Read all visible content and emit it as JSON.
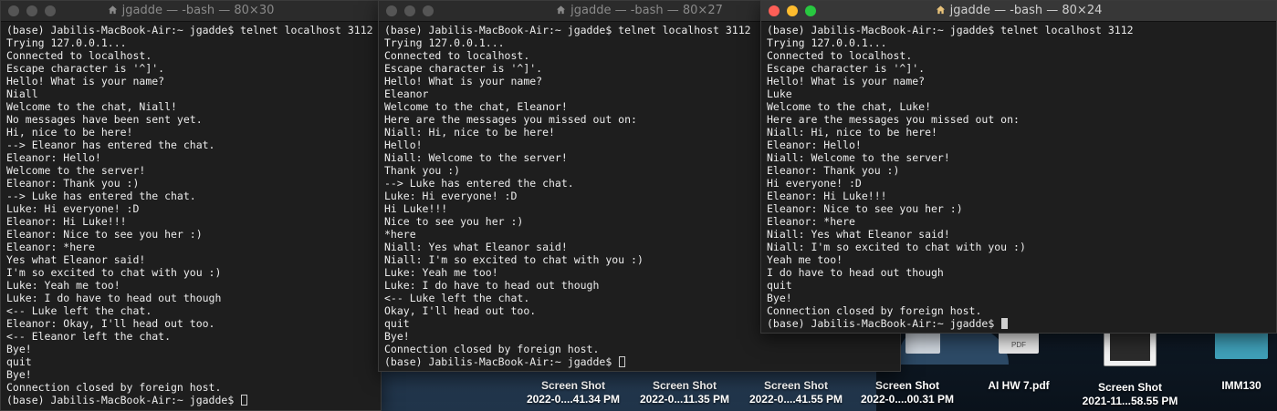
{
  "desktop": {
    "icons": [
      {
        "title": "Screen Shot",
        "subtitle": "2022-0....41.34 PM",
        "thumb_color": "#2c3a4a"
      },
      {
        "title": "Screen Shot",
        "subtitle": "2022-0...11.35 PM",
        "thumb_color": "#2c3a4a"
      },
      {
        "title": "Screen Shot",
        "subtitle": "2022-0....41.55 PM",
        "thumb_color": "#2c3a4a"
      },
      {
        "title": "Screen Shot",
        "subtitle": "2022-0....00.31 PM",
        "thumb_color": "#cfd6de"
      },
      {
        "title": "AI HW 7.pdf",
        "subtitle": "",
        "thumb_color": "#e8e8e8",
        "badge": "PDF"
      },
      {
        "title": "Screen Shot",
        "subtitle": "2021-11...58.55 PM",
        "thumb_color": "#f2f2f2"
      },
      {
        "title": "IMM130",
        "subtitle": "",
        "thumb_color": "#3f9fb8"
      }
    ]
  },
  "terminals": [
    {
      "title": "jgadde — -bash — 80×30",
      "active": false,
      "lines": [
        "(base) Jabilis-MacBook-Air:~ jgadde$ telnet localhost 3112",
        "Trying 127.0.0.1...",
        "Connected to localhost.",
        "Escape character is '^]'.",
        "Hello! What is your name?",
        "Niall",
        "Welcome to the chat, Niall!",
        "No messages have been sent yet.",
        "Hi, nice to be here!",
        "--> Eleanor has entered the chat.",
        "Eleanor: Hello!",
        "Welcome to the server!",
        "Eleanor: Thank you :)",
        "--> Luke has entered the chat.",
        "Luke: Hi everyone! :D",
        "Eleanor: Hi Luke!!!",
        "Eleanor: Nice to see you her :)",
        "Eleanor: *here",
        "Yes what Eleanor said!",
        "I'm so excited to chat with you :)",
        "Luke: Yeah me too!",
        "Luke: I do have to head out though",
        "<-- Luke left the chat.",
        "Eleanor: Okay, I'll head out too.",
        "<-- Eleanor left the chat.",
        "Bye!",
        "quit",
        "Bye!",
        "Connection closed by foreign host.",
        "(base) Jabilis-MacBook-Air:~ jgadde$ "
      ]
    },
    {
      "title": "jgadde — -bash — 80×27",
      "active": false,
      "lines": [
        "(base) Jabilis-MacBook-Air:~ jgadde$ telnet localhost 3112",
        "Trying 127.0.0.1...",
        "Connected to localhost.",
        "Escape character is '^]'.",
        "Hello! What is your name?",
        "Eleanor",
        "Welcome to the chat, Eleanor!",
        "Here are the messages you missed out on:",
        "Niall: Hi, nice to be here!",
        "Hello!",
        "Niall: Welcome to the server!",
        "Thank you :)",
        "--> Luke has entered the chat.",
        "Luke: Hi everyone! :D",
        "Hi Luke!!!",
        "Nice to see you her :)",
        "*here",
        "Niall: Yes what Eleanor said!",
        "Niall: I'm so excited to chat with you :)",
        "Luke: Yeah me too!",
        "Luke: I do have to head out though",
        "<-- Luke left the chat.",
        "Okay, I'll head out too.",
        "quit",
        "Bye!",
        "Connection closed by foreign host.",
        "(base) Jabilis-MacBook-Air:~ jgadde$ "
      ]
    },
    {
      "title": "jgadde — -bash — 80×24",
      "active": true,
      "lines": [
        "(base) Jabilis-MacBook-Air:~ jgadde$ telnet localhost 3112",
        "Trying 127.0.0.1...",
        "Connected to localhost.",
        "Escape character is '^]'.",
        "Hello! What is your name?",
        "Luke",
        "Welcome to the chat, Luke!",
        "Here are the messages you missed out on:",
        "Niall: Hi, nice to be here!",
        "Eleanor: Hello!",
        "Niall: Welcome to the server!",
        "Eleanor: Thank you :)",
        "Hi everyone! :D",
        "Eleanor: Hi Luke!!!",
        "Eleanor: Nice to see you her :)",
        "Eleanor: *here",
        "Niall: Yes what Eleanor said!",
        "Niall: I'm so excited to chat with you :)",
        "Yeah me too!",
        "I do have to head out though",
        "quit",
        "Bye!",
        "Connection closed by foreign host.",
        "(base) Jabilis-MacBook-Air:~ jgadde$ "
      ]
    }
  ]
}
